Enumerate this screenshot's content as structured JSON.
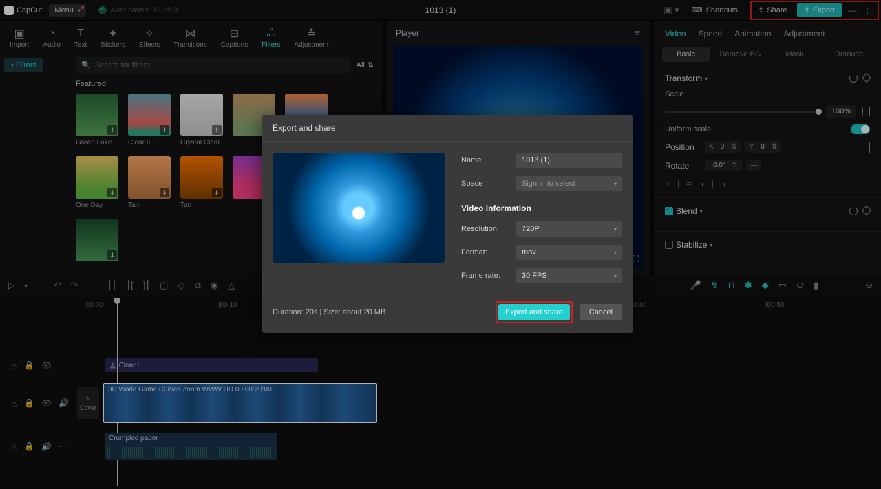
{
  "app": {
    "name": "CapCut",
    "menu": "Menu"
  },
  "autosave": "Auto saved: 13:25:31",
  "project_title": "1013 (1)",
  "shortcuts": "Shortcuts",
  "share_btn": "Share",
  "export_btn": "Export",
  "media_tabs": {
    "import": "Import",
    "audio": "Audio",
    "text": "Text",
    "stickers": "Stickers",
    "effects": "Effects",
    "transitions": "Transitions",
    "captions": "Captions",
    "filters": "Filters",
    "adjustment": "Adjustment"
  },
  "side_pill": "Filters",
  "search_placeholder": "Search for filters",
  "all_label": "All",
  "featured": "Featured",
  "thumbs": [
    {
      "label": "Green Lake",
      "bg": "linear-gradient(#2a6a3a,#5aa55a)"
    },
    {
      "label": "Clear II",
      "bg": "linear-gradient(#6ab,#e66 70%,#3a8 90%)"
    },
    {
      "label": "Crystal Clear",
      "bg": "linear-gradient(#eee,#ccc)"
    },
    {
      "label": "",
      "bg": "linear-gradient(#c96,#8a7 80%)"
    },
    {
      "label": "",
      "bg": "linear-gradient(#f84,#48c 60%)"
    },
    {
      "label": "One Day",
      "bg": "linear-gradient(#ec6,#6b4 80%)"
    },
    {
      "label": "Tan",
      "bg": "linear-gradient(#fa6,#b74)"
    },
    {
      "label": "Tan",
      "bg": "linear-gradient(#f70,#840)"
    },
    {
      "label": "",
      "bg": "linear-gradient(#a4c,#f48 70%)"
    },
    {
      "label": "",
      "bg": "linear-gradient(#000,#af0 70%)"
    },
    {
      "label": "",
      "bg": "linear-gradient(#1a4a2a,#4a9a5a)"
    }
  ],
  "player_title": "Player",
  "right": {
    "tabs": {
      "video": "Video",
      "speed": "Speed",
      "animation": "Animation",
      "adjustment": "Adjustment"
    },
    "sub": {
      "basic": "Basic",
      "removebg": "Remove BG",
      "mask": "Mask",
      "retouch": "Retouch"
    },
    "transform": "Transform",
    "scale": "Scale",
    "scale_val": "100%",
    "uniform": "Uniform scale",
    "position": "Position",
    "x": "X",
    "x_val": "0",
    "y": "Y",
    "y_val": "0",
    "rotate": "Rotate",
    "rotate_val": "0.0°",
    "blend": "Blend",
    "stabilize": "Stabilize"
  },
  "timeline": {
    "ticks": [
      "|00:00",
      "|00:10",
      "|00:40",
      "|00:50"
    ],
    "filter_clip": "Clear II",
    "video_clip": "3D World Globe Curves Zoom WWW HD   00:00:20:00",
    "audio_clip": "Crumpled paper",
    "cover": "Cover"
  },
  "modal": {
    "title": "Export and share",
    "name_lbl": "Name",
    "name_val": "1013 (1)",
    "space_lbl": "Space",
    "space_val": "Sign in to select",
    "vinfo": "Video information",
    "res_lbl": "Resolution:",
    "res_val": "720P",
    "fmt_lbl": "Format:",
    "fmt_val": "mov",
    "fps_lbl": "Frame rate:",
    "fps_val": "30 FPS",
    "duration": "Duration: 20s | Size: about 20 MB",
    "export": "Export and share",
    "cancel": "Cancel"
  }
}
